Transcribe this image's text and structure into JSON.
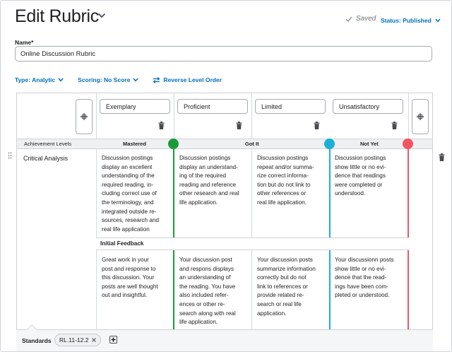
{
  "header": {
    "title": "Edit Rubric",
    "saved_label": "Saved",
    "status_label": "Status: Published"
  },
  "name_field": {
    "label": "Name*",
    "value": "Online Discussion Rubric"
  },
  "options": {
    "type_label": "Type: Analytic",
    "scoring_label": "Scoring: No Score",
    "reverse_label": "Reverse Level Order"
  },
  "levels": [
    {
      "name": "Exemplary"
    },
    {
      "name": "Proficient"
    },
    {
      "name": "Limited"
    },
    {
      "name": "Unsatisfactory"
    }
  ],
  "achievement": {
    "header": "Achievement Levels",
    "mastered": "Mastered",
    "got_it": "Got It",
    "not_yet": "Not Yet",
    "colors": {
      "mastered": "#1a9b3a",
      "got_it": "#19b1d8",
      "not_yet": "#f2555f"
    }
  },
  "criterion": {
    "name": "Critical Analysis",
    "descriptions": [
      [
        "Discussion postings",
        "display an excellent",
        "understanding of the",
        "required reading, in-",
        "cluding correct use of",
        "the terminology, and",
        "integrated outside re-",
        "sources, research and",
        "real life application"
      ],
      [
        "Discussion postings",
        "display an understand-",
        "ing of the required",
        "reading and reference",
        "other research and real",
        "life application."
      ],
      [
        "Discussion postings",
        "repeat and/or summa-",
        "rize correct informa-",
        "tion but do not link to",
        "other references or",
        "real life application."
      ],
      [
        "Discussion postings",
        "show little or no evi-",
        "dence that readings",
        "were completed or",
        "understood."
      ]
    ],
    "feedback_label": "Initial Feedback",
    "feedback": [
      [
        "Great work in your",
        "post and response to",
        "this discussion.  Your",
        "posts are well thought",
        "out and insightful."
      ],
      [
        "Your discussion post",
        "and respons displays",
        "an understanding of",
        "the reading.  You have",
        "also included refer-",
        "ences or other re-",
        "search along with real",
        "life application."
      ],
      [
        "Your discussion posts",
        "summarize information",
        "correctly but do not",
        "link to references or",
        "provide related re-",
        "search or real life",
        "application."
      ],
      [
        "Your discussionn posts",
        "show little or no evi-",
        "dence that the read-",
        "ings have been com-",
        "pleted or understood."
      ]
    ]
  },
  "standards": {
    "label": "Standards",
    "chip": "RL.11-12.2"
  }
}
